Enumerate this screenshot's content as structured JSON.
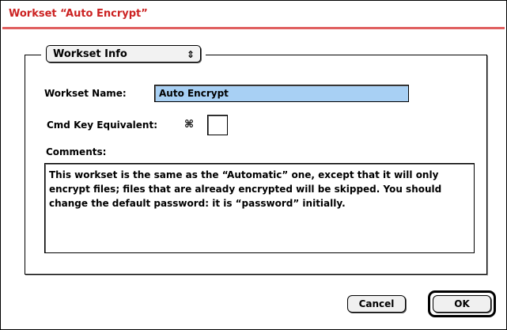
{
  "window": {
    "title": "Workset “Auto Encrypt”",
    "title_color": "#cc2222",
    "accent_line_color": "#e06060"
  },
  "panel": {
    "selector_value": "Workset Info",
    "selector_icon": "up-down-arrows-icon"
  },
  "form": {
    "name_label": "Workset Name:",
    "name_value": "Auto Encrypt",
    "name_highlight_color": "#a8d0f4",
    "cmd_label": "Cmd Key Equivalent:",
    "cmd_symbol": "⌘",
    "cmd_value": "",
    "comments_label": "Comments:",
    "comments_text": "This workset is the same as the “Automatic” one, except that it will only encrypt files; files that are already encrypted will be skipped.  You should change the default password: it is “password” initially."
  },
  "buttons": {
    "cancel_label": "Cancel",
    "ok_label": "OK"
  }
}
